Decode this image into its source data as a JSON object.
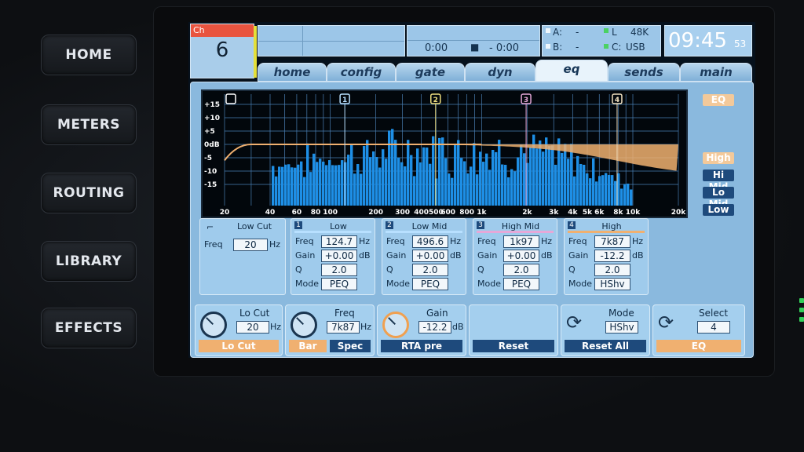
{
  "hardware_buttons": [
    "HOME",
    "METERS",
    "ROUTING",
    "LIBRARY",
    "EFFECTS"
  ],
  "channel": {
    "label": "Ch",
    "number": "6"
  },
  "transport": {
    "time_left": "0:00",
    "time_right": "- 0:00",
    "stop_symbol": "■"
  },
  "io": {
    "a_label": "A:",
    "a_value": "-",
    "b_label": "B:",
    "b_value": "-",
    "l_label": "L",
    "l_value": "48K",
    "c_label": "C:",
    "c_value": "USB"
  },
  "clock": {
    "time": "09:45",
    "seconds": "53"
  },
  "tabs": [
    "home",
    "config",
    "gate",
    "dyn",
    "eq",
    "sends",
    "main"
  ],
  "active_tab": "eq",
  "graph": {
    "db_ticks": [
      "+15",
      "+10",
      "+5",
      "0dB",
      "-5",
      "-10",
      "-15"
    ],
    "freq_ticks": [
      "20",
      "40",
      "60",
      "80",
      "100",
      "200",
      "300",
      "400",
      "500",
      "600",
      "800",
      "1k",
      "2k",
      "3k",
      "4k",
      "5k",
      "6k",
      "8k",
      "10k",
      "20k"
    ],
    "band_markers": [
      "1",
      "2",
      "3",
      "4"
    ]
  },
  "side": {
    "eq_label": "EQ",
    "bands": [
      "High",
      "Hi Mid",
      "Lo Mid",
      "Low"
    ]
  },
  "low_cut": {
    "title": "Low Cut",
    "freq_label": "Freq",
    "freq": "20",
    "unit": "Hz"
  },
  "bands": [
    {
      "num": "1",
      "title": "Low",
      "freq": "124.7",
      "gain": "+0.00",
      "q": "2.0",
      "mode": "PEQ"
    },
    {
      "num": "2",
      "title": "Low Mid",
      "freq": "496.6",
      "gain": "+0.00",
      "q": "2.0",
      "mode": "PEQ"
    },
    {
      "num": "3",
      "title": "High Mid",
      "freq": "1k97",
      "gain": "+0.00",
      "q": "2.0",
      "mode": "PEQ"
    },
    {
      "num": "4",
      "title": "High",
      "freq": "7k87",
      "gain": "-12.2",
      "q": "2.0",
      "mode": "HShv"
    }
  ],
  "labels": {
    "freq": "Freq",
    "gain": "Gain",
    "q": "Q",
    "mode": "Mode",
    "hz": "Hz",
    "db": "dB"
  },
  "controls": {
    "locut": {
      "title": "Lo Cut",
      "value": "20",
      "unit": "Hz",
      "footer": "Lo Cut"
    },
    "freq": {
      "title": "Freq",
      "value": "7k87",
      "unit": "Hz",
      "opt1": "Bar",
      "opt2": "Spec"
    },
    "gain": {
      "title": "Gain",
      "value": "-12.2",
      "unit": "dB",
      "footer": "RTA pre"
    },
    "reset": {
      "footer": "Reset"
    },
    "mode": {
      "title": "Mode",
      "value": "HShv",
      "footer": "Reset All"
    },
    "select": {
      "title": "Select",
      "value": "4",
      "footer": "EQ"
    }
  },
  "colors": {
    "accent": "#f0b070",
    "spectrum": "#1e8fe6",
    "panel": "#8ab9de"
  }
}
